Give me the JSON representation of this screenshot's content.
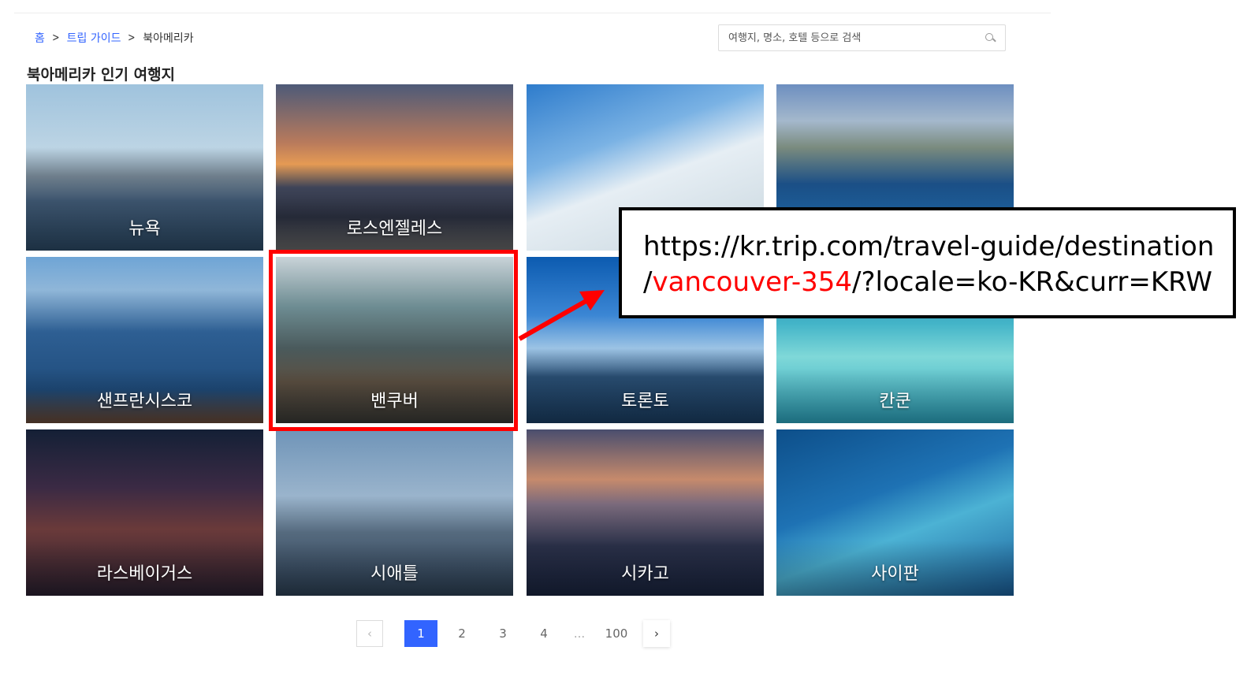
{
  "breadcrumb": {
    "home": "홈",
    "guide": "트립 가이드",
    "current": "북아메리카"
  },
  "search": {
    "placeholder": "여행지, 명소, 호텔 등으로 검색"
  },
  "section_title": "북아메리카 인기 여행지",
  "destinations": [
    {
      "label": "뉴욕"
    },
    {
      "label": "로스엔젤레스"
    },
    {
      "label": ""
    },
    {
      "label": ""
    },
    {
      "label": "샌프란시스코"
    },
    {
      "label": "밴쿠버"
    },
    {
      "label": "토론토"
    },
    {
      "label": "칸쿤"
    },
    {
      "label": "라스베이거스"
    },
    {
      "label": "시애틀"
    },
    {
      "label": "시카고"
    },
    {
      "label": "사이판"
    }
  ],
  "callout": {
    "url_line1": "https://kr.trip.com/travel-guide/destination",
    "url_slash": "/",
    "url_highlight": "vancouver-354",
    "url_rest": "/?locale=ko-KR&curr=KRW"
  },
  "pagination": {
    "pages": [
      "1",
      "2",
      "3",
      "4"
    ],
    "ellipsis": "...",
    "last": "100",
    "current": "1"
  },
  "colors": {
    "accent": "#3264ff",
    "highlight": "#ff0000"
  }
}
